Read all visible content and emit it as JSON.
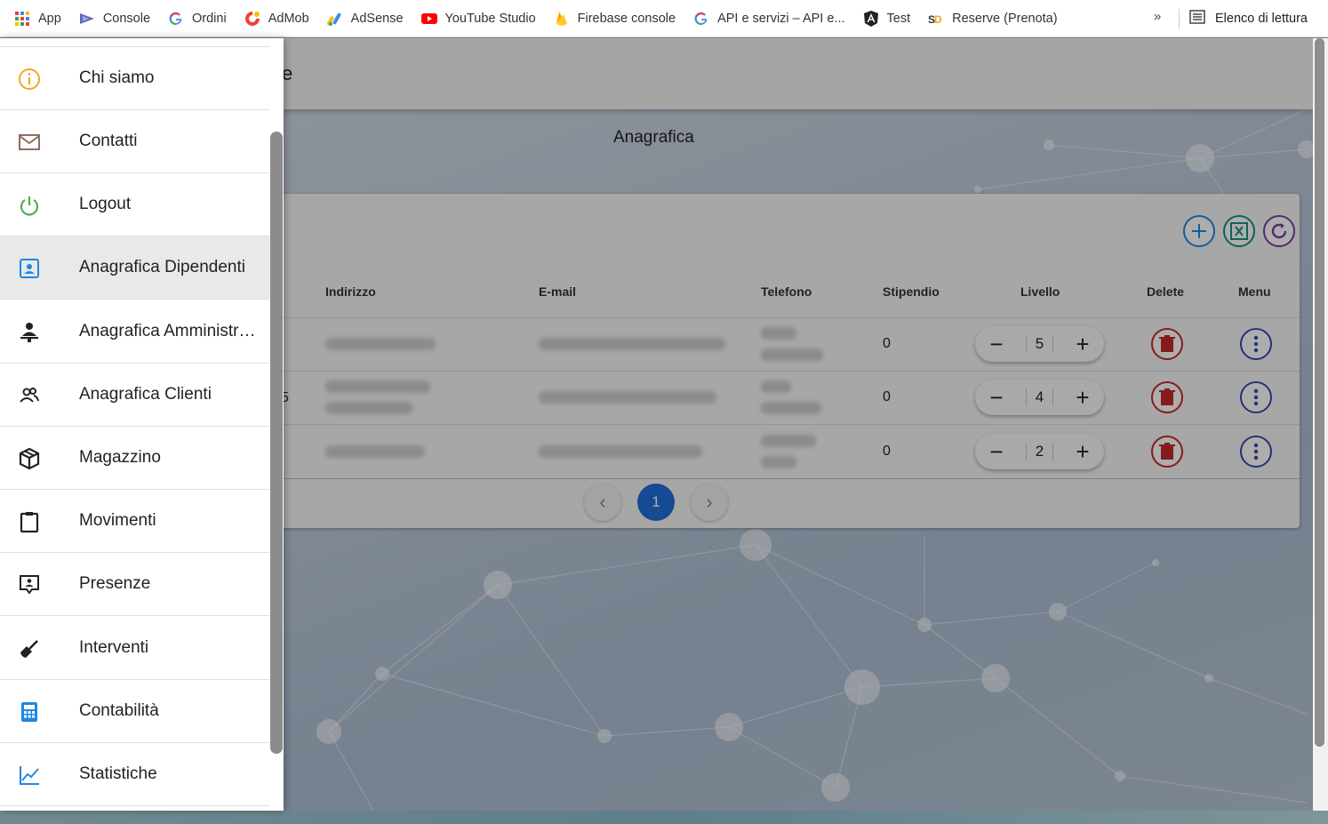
{
  "bookmarks": {
    "items": [
      {
        "label": "App",
        "icon": "apps-grid-icon"
      },
      {
        "label": "Console",
        "icon": "console-icon"
      },
      {
        "label": "Ordini",
        "icon": "google-icon"
      },
      {
        "label": "AdMob",
        "icon": "admob-icon"
      },
      {
        "label": "AdSense",
        "icon": "adsense-icon"
      },
      {
        "label": "YouTube Studio",
        "icon": "youtube-icon"
      },
      {
        "label": "Firebase console",
        "icon": "firebase-icon"
      },
      {
        "label": "API e servizi – API e...",
        "icon": "google-icon"
      },
      {
        "label": "Test",
        "icon": "angular-icon"
      },
      {
        "label": "Reserve (Prenota)",
        "icon": "reserve-icon"
      }
    ],
    "more": "»",
    "reading_list": "Elenco di lettura"
  },
  "app": {
    "appbar_title": "ce",
    "page_heading": "Anagrafica",
    "table": {
      "headers": {
        "indirizzo": "Indirizzo",
        "email": "E-mail",
        "telefono": "Telefono",
        "stipendio": "Stipendio",
        "livello": "Livello",
        "delete": "Delete",
        "menu": "Menu"
      },
      "rows": [
        {
          "lead": "",
          "stipendio": "0",
          "livello": "5"
        },
        {
          "lead": "5",
          "stipendio": "0",
          "livello": "4"
        },
        {
          "lead": "",
          "stipendio": "0",
          "livello": "2"
        }
      ],
      "stepper_minus": "−",
      "stepper_plus": "+"
    },
    "pagination": {
      "prev": "‹",
      "current": "1",
      "next": "›"
    }
  },
  "drawer": {
    "items": [
      {
        "label": "Chi siamo",
        "icon": "info-icon",
        "color": "#f5a623"
      },
      {
        "label": "Contatti",
        "icon": "mail-icon",
        "color": "#8d6e63"
      },
      {
        "label": "Logout",
        "icon": "power-icon",
        "color": "#4caf50"
      },
      {
        "label": "Anagrafica Dipendenti",
        "icon": "contact-card-icon",
        "color": "#1e88e5",
        "active": true
      },
      {
        "label": "Anagrafica Amministratori",
        "icon": "admin-user-icon",
        "color": "#222222"
      },
      {
        "label": "Anagrafica Clienti",
        "icon": "people-icon",
        "color": "#222222"
      },
      {
        "label": "Magazzino",
        "icon": "package-icon",
        "color": "#222222"
      },
      {
        "label": "Movimenti",
        "icon": "clipboard-icon",
        "color": "#222222"
      },
      {
        "label": "Presenze",
        "icon": "presence-icon",
        "color": "#222222"
      },
      {
        "label": "Interventi",
        "icon": "cleaning-icon",
        "color": "#222222"
      },
      {
        "label": "Contabilità",
        "icon": "calculator-icon",
        "color": "#1e88e5"
      },
      {
        "label": "Statistiche",
        "icon": "chart-line-icon",
        "color": "#1e88e5"
      }
    ]
  },
  "colors": {
    "accent": "#1e6fd9",
    "add_button": "#1e88e5",
    "excel_button": "#1e8e7e",
    "refresh_button": "#7b3fa0",
    "delete": "#c62828",
    "menu": "#3949ab"
  }
}
